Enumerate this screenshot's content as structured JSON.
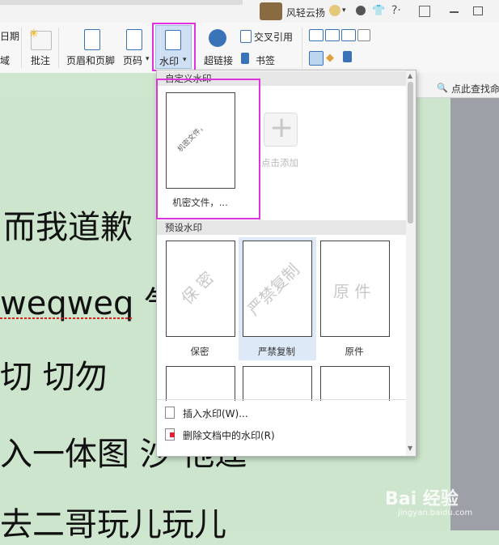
{
  "topbar": {
    "username": "风轻云扬",
    "icons": [
      "avatar-face-icon",
      "chevron-down-icon",
      "skin-icon",
      "shirt-icon",
      "help-icon",
      "restore-icon",
      "minimize-icon",
      "maximize-icon"
    ]
  },
  "ribbon": {
    "left_partial_1": "日期",
    "left_partial_2": "域",
    "comment": "批注",
    "header_footer": "页眉和页脚",
    "page_number": "页码",
    "watermark": "水印",
    "hyperlink": "超链接",
    "cross_ref": "交叉引用",
    "bookmark": "书签",
    "find_label": "点此查找命"
  },
  "document": {
    "lines": [
      "而我道歉",
      "weqweq 气",
      "切    切勿",
      "入一体图 沙 他逞",
      "去二哥玩儿玩儿"
    ]
  },
  "dropdown": {
    "section_custom": "自定义水印",
    "custom_thumb_text": "机密文件，",
    "custom_label": "机密文件，...",
    "add_label": "点击添加",
    "section_preset": "预设水印",
    "presets": [
      {
        "label": "保密",
        "watermark": "保 密"
      },
      {
        "label": "严禁复制",
        "watermark": "严禁复制"
      },
      {
        "label": "原件",
        "watermark": "原 件"
      }
    ],
    "insert": "插入水印(W)...",
    "remove": "删除文档中的水印(R)"
  },
  "brand": {
    "logo": "Bai 经验",
    "url": "jingyan.baidu.com"
  }
}
